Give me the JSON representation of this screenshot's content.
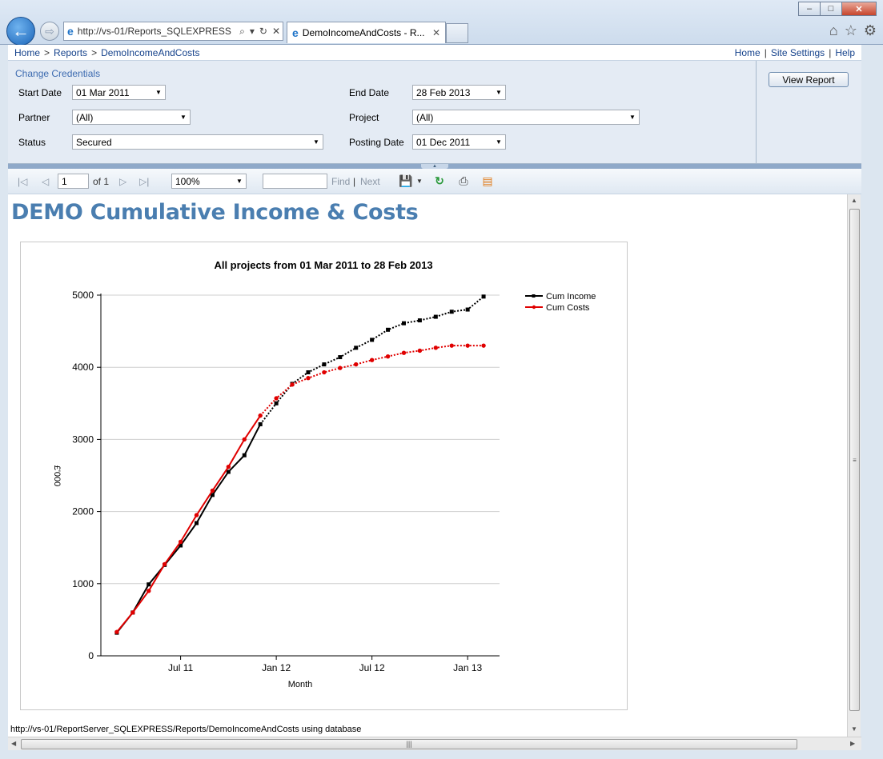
{
  "browser": {
    "address": "http://vs-01/Reports_SQLEXPRESS",
    "tab_title": "DemoIncomeAndCosts - R...",
    "back_glyph": "←",
    "forward_glyph": "⇨",
    "search_glyph": "⌕",
    "dropdown_glyph": "▾",
    "refresh_glyph": "↻",
    "stop_glyph": "✕",
    "tab_close_glyph": "✕",
    "home_glyph": "⌂",
    "favorites_glyph": "☆",
    "tools_glyph": "⚙",
    "minimize_glyph": "–",
    "maximize_glyph": "□",
    "close_glyph": "✕"
  },
  "breadcrumb": {
    "items": [
      "Home",
      "Reports",
      "DemoIncomeAndCosts"
    ],
    "separator": ">",
    "right_links": [
      "Home",
      "Site Settings",
      "Help"
    ],
    "right_separator": "|"
  },
  "params": {
    "change_credentials": "Change Credentials",
    "start_date": {
      "label": "Start Date",
      "value": "01 Mar 2011"
    },
    "end_date": {
      "label": "End Date",
      "value": "28 Feb 2013"
    },
    "partner": {
      "label": "Partner",
      "value": "(All)"
    },
    "project": {
      "label": "Project",
      "value": "(All)"
    },
    "status": {
      "label": "Status",
      "value": "Secured"
    },
    "posting_date": {
      "label": "Posting Date",
      "value": "01 Dec 2011"
    },
    "view_report": "View Report",
    "dropdown_glyph": "▼",
    "collapse_glyph": "▲"
  },
  "toolbar": {
    "first_glyph": "|◁",
    "prev_glyph": "◁",
    "page": "1",
    "of_pages": "of 1",
    "next_glyph": "▷",
    "last_glyph": "▷|",
    "zoom": "100%",
    "find_value": "",
    "find": "Find",
    "find_sep": "|",
    "next": "Next",
    "export_glyph": "💾",
    "refresh_glyph": "↻",
    "print_glyph": "⎙",
    "data_feed_glyph": "▤",
    "dropdown_glyph": "▼"
  },
  "report": {
    "title": "DEMO Cumulative Income & Costs",
    "status_line": "http://vs-01/ReportServer_SQLEXPRESS/Reports/DemoIncomeAndCosts using database"
  },
  "scrollbars": {
    "up_glyph": "▲",
    "down_glyph": "▼",
    "left_glyph": "◀",
    "right_glyph": "▶",
    "grip_glyph": "≡",
    "hgrip_glyph": "|||"
  },
  "chart_data": {
    "type": "line",
    "title": "All projects from 01 Mar 2011 to 28 Feb 2013",
    "xlabel": "Month",
    "ylabel": "£'000",
    "ylim": [
      0,
      5000
    ],
    "yticks": [
      0,
      1000,
      2000,
      3000,
      4000,
      5000
    ],
    "xticks": [
      "Jul 11",
      "Jan 12",
      "Jul 12",
      "Jan 13"
    ],
    "x_range": [
      "Feb 2011",
      "Mar 2013"
    ],
    "grid": "horizontal",
    "legend_position": "top-right",
    "x": [
      "Mar 11",
      "Apr 11",
      "May 11",
      "Jun 11",
      "Jul 11",
      "Aug 11",
      "Sep 11",
      "Oct 11",
      "Nov 11",
      "Dec 11",
      "Jan 12",
      "Feb 12",
      "Mar 12",
      "Apr 12",
      "May 12",
      "Jun 12",
      "Jul 12",
      "Aug 12",
      "Sep 12",
      "Oct 12",
      "Nov 12",
      "Dec 12",
      "Jan 13",
      "Feb 13"
    ],
    "actual_through": "Dec 11",
    "series": [
      {
        "name": "Cum Income",
        "color": "#000000",
        "marker": "square",
        "values": [
          320,
          600,
          990,
          1260,
          1530,
          1840,
          2230,
          2550,
          2780,
          3210,
          3500,
          3770,
          3930,
          4040,
          4140,
          4270,
          4380,
          4520,
          4610,
          4650,
          4700,
          4770,
          4800,
          4980
        ]
      },
      {
        "name": "Cum Costs",
        "color": "#e00000",
        "marker": "circle",
        "values": [
          330,
          600,
          900,
          1270,
          1580,
          1950,
          2290,
          2620,
          3000,
          3330,
          3570,
          3760,
          3850,
          3930,
          3990,
          4040,
          4100,
          4150,
          4200,
          4230,
          4270,
          4300,
          4300,
          4300
        ]
      }
    ]
  }
}
